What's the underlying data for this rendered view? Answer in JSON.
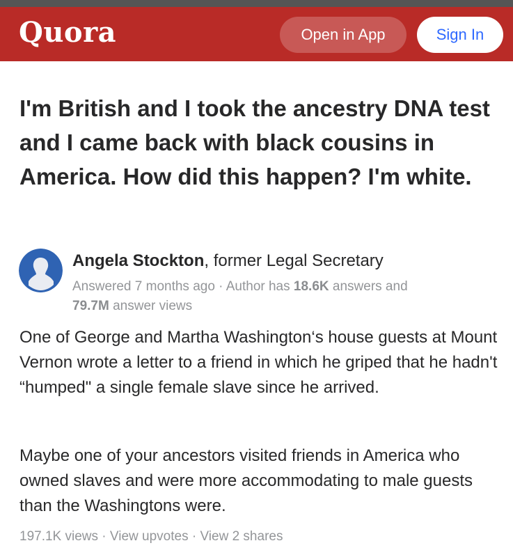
{
  "header": {
    "logo": "Quora",
    "open_in_app": "Open in App",
    "sign_in": "Sign In"
  },
  "question": {
    "title": "I'm British and I took the ancestry DNA test and I came back with black cousins in America. How did this happen? I'm white."
  },
  "author": {
    "name": "Angela Stockton",
    "credential": ", former Legal Secretary",
    "answered_prefix": "Answered 7 months ago · Author has ",
    "answers_count": "18.6K",
    "answers_suffix": " answers and",
    "views_count": "79.7M",
    "views_suffix": " answer views"
  },
  "answer": {
    "paragraphs": [
      "One of George and Martha Washington‘s house guests at Mount Vernon wrote a letter to a friend in which he griped that he hadn't “humped\" a single female slave since he arrived.",
      "Maybe one of your ancestors visited friends in America who owned slaves and were more accommodating to male guests than the Washingtons were."
    ]
  },
  "footer": {
    "views": "197.1K views",
    "separator": " · ",
    "view_upvotes": "View upvotes",
    "view_shares": "View 2 shares"
  },
  "colors": {
    "brand": "#b92b27",
    "sign_in_text": "#2e69ff",
    "avatar_bg": "#2f63b3",
    "muted": "#939598"
  },
  "icons": {
    "avatar": "default-profile-silhouette"
  }
}
